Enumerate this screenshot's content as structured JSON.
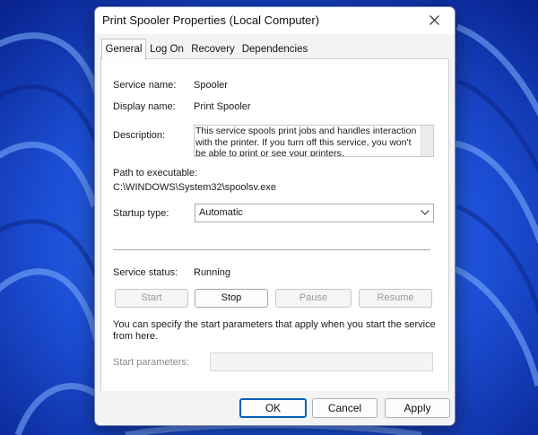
{
  "window": {
    "title": "Print Spooler Properties (Local Computer)"
  },
  "tabs": [
    {
      "label": "General",
      "active": true
    },
    {
      "label": "Log On",
      "active": false
    },
    {
      "label": "Recovery",
      "active": false
    },
    {
      "label": "Dependencies",
      "active": false
    }
  ],
  "general": {
    "service_name_label": "Service name:",
    "service_name_value": "Spooler",
    "display_name_label": "Display name:",
    "display_name_value": "Print Spooler",
    "description_label": "Description:",
    "description_value": "This service spools print jobs and handles interaction with the printer.  If you turn off this service, you won't be able to print or see your printers.",
    "path_label": "Path to executable:",
    "path_value": "C:\\WINDOWS\\System32\\spoolsv.exe",
    "startup_type_label": "Startup type:",
    "startup_type_value": "Automatic",
    "service_status_label": "Service status:",
    "service_status_value": "Running",
    "control_buttons": {
      "start": "Start",
      "stop": "Stop",
      "pause": "Pause",
      "resume": "Resume"
    },
    "params_hint": "You can specify the start parameters that apply when you start the service from here.",
    "start_params_label": "Start parameters:",
    "start_params_value": ""
  },
  "footer": {
    "ok": "OK",
    "cancel": "Cancel",
    "apply": "Apply"
  },
  "colors": {
    "accent": "#005fb8",
    "wallpaper": "#1540c8"
  },
  "icons": {
    "close": "close-icon",
    "dropdown": "chevron-down-icon"
  }
}
